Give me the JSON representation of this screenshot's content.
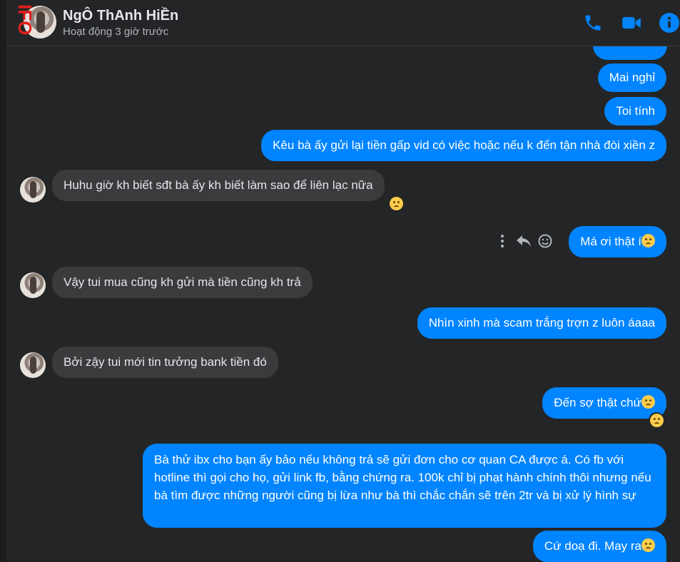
{
  "header": {
    "name": "NgÔ ThAnh HiỀn",
    "status": "Hoạt động 3 giờ trước",
    "watermark": "IFO",
    "icons": [
      "phone-icon",
      "video-icon",
      "info-icon"
    ],
    "accent": "#0084ff"
  },
  "messages": [
    {
      "from": "me",
      "text": "Mai nghỉ"
    },
    {
      "from": "me",
      "text": "Toi tính"
    },
    {
      "from": "me",
      "text": "Kêu bà ấy gửi lại tiền gấp vid có việc hoặc nếu k đến tận nhà đòi xiền z"
    },
    {
      "from": "them",
      "text": "Huhu giờ kh biết sđt bà ấy kh biết làm sao để liên lạc nữa"
    },
    {
      "from": "me",
      "text": "Má ơi thật í"
    },
    {
      "from": "them",
      "text": "Vậy tui mua cũng kh gửi mà tiền cũng kh trả"
    },
    {
      "from": "me",
      "text": "Nhìn xinh mà scam trắng trợn z luôn áaaa"
    },
    {
      "from": "them",
      "text": "Bởi zậy tui mới tin tưởng bank tiền đó"
    },
    {
      "from": "me",
      "text": "Đến sợ thật chứ"
    },
    {
      "from": "me",
      "text": "Bà thử ibx cho bạn ấy bảo nếu không trả sẽ gửi đơn cho cơ quan CA được á. Có fb với hotline thì gọi cho họ, gửi link fb, bằng chứng ra. 100k chỉ bị phạt hành chính thôi nhưng nếu bà tìm được những người cũng bị lừa như bà thì chắc chắn sẽ trên 2tr và bị xử lý hình sự"
    },
    {
      "from": "me",
      "text": "Cứ doạ đi. May ra"
    }
  ],
  "colors": {
    "outgoing": "#0084ff",
    "incoming": "#3a3b3c",
    "background": "#242526"
  }
}
